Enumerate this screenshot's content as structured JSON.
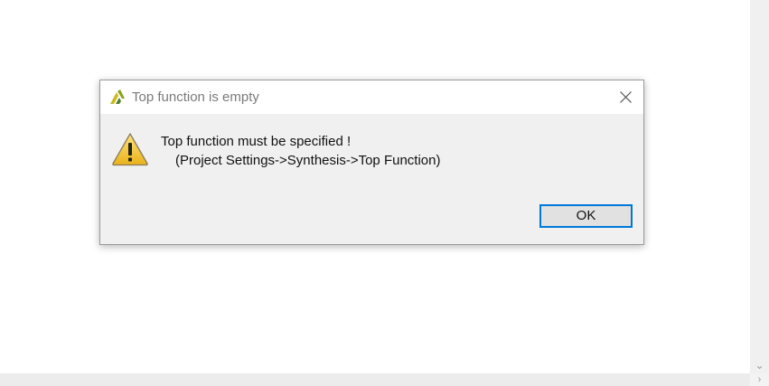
{
  "dialog": {
    "title": "Top function is empty",
    "message_line1": "Top function must be specified !",
    "message_line2": "(Project Settings->Synthesis->Top Function)",
    "ok_label": "OK",
    "icons": {
      "app": "xilinx-logo-icon",
      "close": "close-icon",
      "message": "warning-icon"
    }
  },
  "scrollbars": {
    "vertical_arrow": "⌄",
    "corner_arrow": "›"
  },
  "colors": {
    "accent": "#0078d7",
    "dialog_body": "#f0f0f0",
    "warning_yellow": "#f3c623"
  }
}
